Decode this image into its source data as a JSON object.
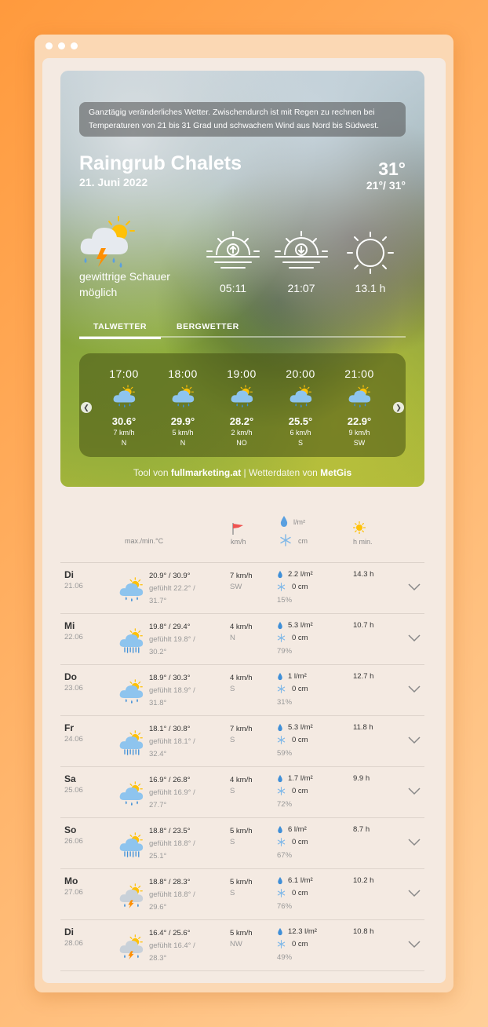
{
  "summary": "Ganztägig veränderliches Wetter. Zwischendurch ist mit Regen zu rechnen bei Temperaturen von 21 bis 31 Grad und schwachem Wind aus Nord bis Südwest.",
  "location": "Raingrub Chalets",
  "date": "21. Juni 2022",
  "temp_now": "31°",
  "temp_minmax": "21°/ 31°",
  "condition": "gewittrige Schauer möglich",
  "sunrise": "05:11",
  "sunset": "21:07",
  "sun_hours": "13.1 h",
  "tabs": [
    "TALWETTER",
    "BERGWETTER"
  ],
  "hourly": [
    {
      "time": "17:00",
      "temp": "30.6°",
      "wind": "7 km/h",
      "dir": "N"
    },
    {
      "time": "18:00",
      "temp": "29.9°",
      "wind": "5 km/h",
      "dir": "N"
    },
    {
      "time": "19:00",
      "temp": "28.2°",
      "wind": "2 km/h",
      "dir": "NO"
    },
    {
      "time": "20:00",
      "temp": "25.5°",
      "wind": "6 km/h",
      "dir": "S"
    },
    {
      "time": "21:00",
      "temp": "22.9°",
      "wind": "9 km/h",
      "dir": "SW"
    }
  ],
  "credit": {
    "prefix": "Tool von ",
    "brand": "fullmarketing.at",
    "mid": " | Wetterdaten von ",
    "source": "MetGis"
  },
  "headers": {
    "temp": "max./min.°C",
    "wind": "km/h",
    "rain": "l/m²",
    "snow": "cm",
    "sun": "h min."
  },
  "forecast": [
    {
      "day": "Di",
      "date": "21.06",
      "icon": "cloud-sun-rain",
      "temp": "20.9° / 30.9°",
      "feel": "gefühlt 22.2° / 31.7°",
      "wind": "7 km/h",
      "dir": "SW",
      "rain": "2.2 l/m²",
      "snow": "0 cm",
      "pct": "15%",
      "sun": "14.3 h"
    },
    {
      "day": "Mi",
      "date": "22.06",
      "icon": "cloud-sun-heavy-rain",
      "temp": "19.8° / 29.4°",
      "feel": "gefühlt 19.8° / 30.2°",
      "wind": "4 km/h",
      "dir": "N",
      "rain": "5.3 l/m²",
      "snow": "0 cm",
      "pct": "79%",
      "sun": "10.7 h"
    },
    {
      "day": "Do",
      "date": "23.06",
      "icon": "cloud-sun-rain",
      "temp": "18.9° / 30.3°",
      "feel": "gefühlt 18.9° / 31.8°",
      "wind": "4 km/h",
      "dir": "S",
      "rain": "1 l/m²",
      "snow": "0 cm",
      "pct": "31%",
      "sun": "12.7 h"
    },
    {
      "day": "Fr",
      "date": "24.06",
      "icon": "cloud-sun-heavy-rain",
      "temp": "18.1° / 30.8°",
      "feel": "gefühlt 18.1° / 32.4°",
      "wind": "7 km/h",
      "dir": "S",
      "rain": "5.3 l/m²",
      "snow": "0 cm",
      "pct": "59%",
      "sun": "11.8 h"
    },
    {
      "day": "Sa",
      "date": "25.06",
      "icon": "cloud-sun-rain",
      "temp": "16.9° / 26.8°",
      "feel": "gefühlt 16.9° / 27.7°",
      "wind": "4 km/h",
      "dir": "S",
      "rain": "1.7 l/m²",
      "snow": "0 cm",
      "pct": "72%",
      "sun": "9.9 h"
    },
    {
      "day": "So",
      "date": "26.06",
      "icon": "cloud-sun-heavy-rain",
      "temp": "18.8° / 23.5°",
      "feel": "gefühlt 18.8° / 25.1°",
      "wind": "5 km/h",
      "dir": "S",
      "rain": "6 l/m²",
      "snow": "0 cm",
      "pct": "67%",
      "sun": "8.7 h"
    },
    {
      "day": "Mo",
      "date": "27.06",
      "icon": "cloud-sun-thunder",
      "temp": "18.8° / 28.3°",
      "feel": "gefühlt 18.8° / 29.6°",
      "wind": "5 km/h",
      "dir": "S",
      "rain": "6.1 l/m²",
      "snow": "0 cm",
      "pct": "76%",
      "sun": "10.2 h"
    },
    {
      "day": "Di",
      "date": "28.06",
      "icon": "cloud-sun-thunder",
      "temp": "16.4° / 25.6°",
      "feel": "gefühlt 16.4° / 28.3°",
      "wind": "5 km/h",
      "dir": "NW",
      "rain": "12.3 l/m²",
      "snow": "0 cm",
      "pct": "49%",
      "sun": "10.8 h"
    }
  ]
}
